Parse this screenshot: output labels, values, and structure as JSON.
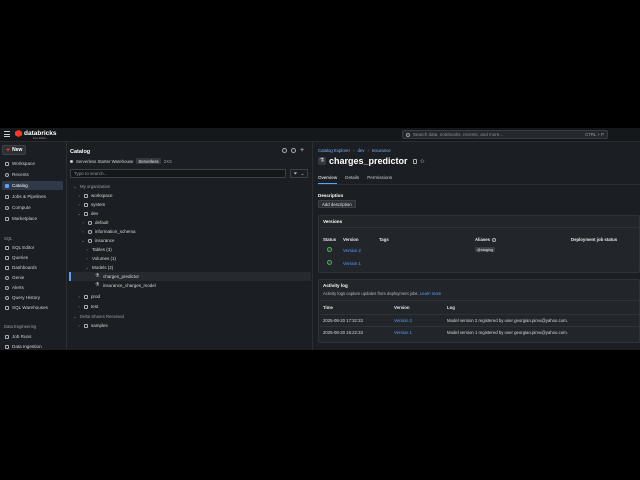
{
  "topbar": {
    "logo_text": "databricks",
    "logo_sub": "Free Edition",
    "search_placeholder": "Search data, notebooks, recents, and more...",
    "search_shortcut": "CTRL + P"
  },
  "nav": {
    "new_label": "New",
    "items": [
      {
        "label": "Workspace",
        "icon": "folder-icon"
      },
      {
        "label": "Recents",
        "icon": "clock-icon"
      },
      {
        "label": "Catalog",
        "icon": "catalog-icon",
        "active": true
      },
      {
        "label": "Jobs & Pipelines",
        "icon": "jobs-icon"
      },
      {
        "label": "Compute",
        "icon": "cloud-icon"
      },
      {
        "label": "Marketplace",
        "icon": "store-icon"
      }
    ],
    "sql_section": "SQL",
    "sql_items": [
      {
        "label": "SQL Editor",
        "icon": "editor-icon"
      },
      {
        "label": "Queries",
        "icon": "queries-icon"
      },
      {
        "label": "Dashboards",
        "icon": "dashboard-icon"
      },
      {
        "label": "Genie",
        "icon": "genie-icon"
      },
      {
        "label": "Alerts",
        "icon": "bell-icon"
      },
      {
        "label": "Query History",
        "icon": "history-icon"
      },
      {
        "label": "SQL Warehouses",
        "icon": "warehouse-icon"
      }
    ],
    "de_section": "Data Engineering",
    "de_items": [
      {
        "label": "Job Runs",
        "icon": "runs-icon"
      },
      {
        "label": "Data Ingestion",
        "icon": "ingest-icon"
      }
    ]
  },
  "catalog": {
    "title": "Catalog",
    "warehouse": "Serverless Starter Warehouse",
    "warehouse_badge": "Serverless",
    "warehouse_size": "2XS",
    "search_placeholder": "Type to search...",
    "tree": {
      "my_org": "My organization",
      "workspace": "workspace",
      "system": "system",
      "dev": "dev",
      "default": "default",
      "information_schema": "information_schema",
      "insurance": "insurance",
      "tables": "Tables (3)",
      "volumes": "Volumes (1)",
      "models": "Models (2)",
      "model1": "charges_predictor",
      "model2": "insurance_charges_model",
      "prod": "prod",
      "test": "test",
      "delta_shares": "Delta Shares Received",
      "samples": "samples"
    }
  },
  "main": {
    "breadcrumbs": [
      "Catalog Explorer",
      "dev",
      "Insurance"
    ],
    "title": "charges_predictor",
    "tabs": [
      "Overview",
      "Details",
      "Permissions"
    ],
    "description_label": "Description",
    "add_description": "Add description",
    "versions": {
      "title": "Versions",
      "headers": [
        "Status",
        "Version",
        "Tags",
        "Aliases",
        "Deployment job status"
      ],
      "rows": [
        {
          "version": "Version 2",
          "alias": "@staging"
        },
        {
          "version": "Version 1",
          "alias": ""
        }
      ]
    },
    "activity": {
      "title": "Activity log",
      "subtitle": "Activity logs capture updates from deployment jobs.",
      "learn_more": "Learn more",
      "headers": [
        "Time",
        "Version",
        "Log"
      ],
      "rows": [
        {
          "time": "2025-08-20 17:32:33",
          "version": "Version 2",
          "log": "Model version 2 registered by user georgian.pirvu@yahoo.com."
        },
        {
          "time": "2025-08-20 16:22:33",
          "version": "Version 1",
          "log": "Model version 1 registered by user georgian.pirvu@yahoo.com."
        }
      ]
    }
  }
}
